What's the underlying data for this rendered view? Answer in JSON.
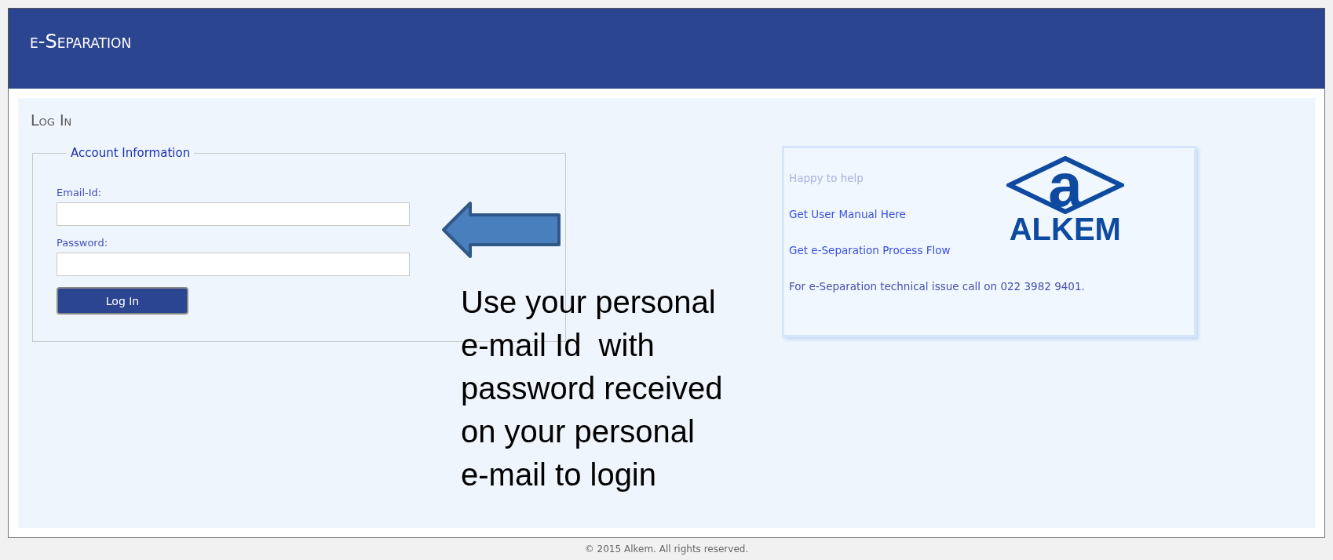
{
  "header": {
    "title": "e-Separation"
  },
  "page_title": "Log In",
  "account": {
    "legend": "Account Information",
    "fields": [
      {
        "label": "Email-Id:"
      },
      {
        "label": "Password:"
      }
    ],
    "button": "Log In"
  },
  "annotation": {
    "lines": [
      "Use your personal",
      "e-mail Id  with",
      "password received",
      "on your personal",
      "e-mail to login"
    ]
  },
  "help": {
    "heading": "Happy to help",
    "links": [
      "Get User Manual Here",
      "Get e-Separation Process Flow"
    ],
    "note": "For e-Separation technical issue call on 022 3982 9401.",
    "logo": {
      "mark": "a",
      "name": "ALKEM"
    }
  },
  "footer": "© 2015 Alkem. All rights reserved."
}
